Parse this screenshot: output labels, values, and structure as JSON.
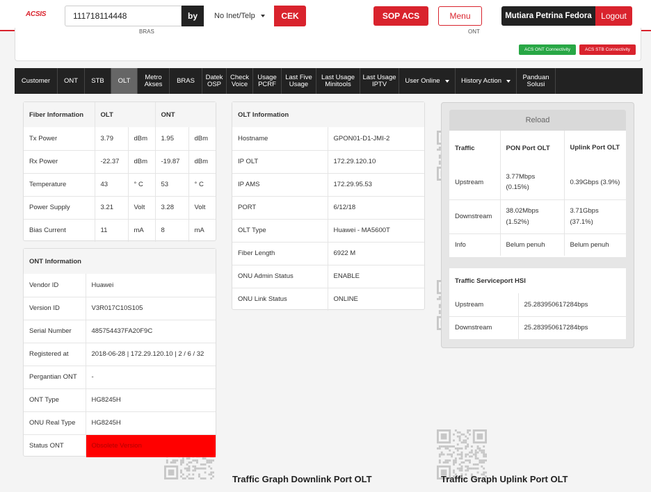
{
  "header": {
    "logo": "ACSIS",
    "logo_sub": "...........",
    "search_value": "111718114448",
    "by_label": "by",
    "select_value": "No Inet/Telp",
    "cek_label": "CEK",
    "sop_label": "SOP ACS",
    "menu_label": "Menu",
    "user_name": "Mutiara Petrina Fedora",
    "logout_label": "Logout"
  },
  "summary": {
    "bras_label": "BRAS",
    "ont_label": "ONT",
    "badge_ont": "ACS ONT Connectivity",
    "badge_stb": "ACS STB Connectivity"
  },
  "tabs": [
    {
      "label": "Customer",
      "w": 62
    },
    {
      "label": "ONT",
      "w": 39
    },
    {
      "label": "STB",
      "w": 38
    },
    {
      "label": "OLT",
      "w": 38,
      "active": true
    },
    {
      "label": "Metro\nAkses",
      "w": 46
    },
    {
      "label": "BRAS",
      "w": 47
    },
    {
      "label": "Datek\nOSP",
      "w": 35
    },
    {
      "label": "Check\nVoice",
      "w": 38
    },
    {
      "label": "Usage\nPCRF",
      "w": 41
    },
    {
      "label": "Last Five\nUsage",
      "w": 50
    },
    {
      "label": "Last Usage\nMinitools",
      "w": 63
    },
    {
      "label": "Last Usage\nIPTV",
      "w": 56
    },
    {
      "label": "User Online",
      "w": 81,
      "dropdown": true
    },
    {
      "label": "History Action",
      "w": 88,
      "dropdown": true
    },
    {
      "label": "Panduan\nSolusi",
      "w": 56
    }
  ],
  "fiber": {
    "headers": [
      "Fiber Information",
      "OLT",
      "ONT"
    ],
    "rows": [
      {
        "label": "Tx Power",
        "olt": "3.79",
        "olt_unit": "dBm",
        "ont": "1.95",
        "ont_unit": "dBm"
      },
      {
        "label": "Rx Power",
        "olt": "-22.37",
        "olt_unit": "dBm",
        "ont": "-19.87",
        "ont_unit": "dBm"
      },
      {
        "label": "Temperature",
        "olt": "43",
        "olt_unit": "° C",
        "ont": "53",
        "ont_unit": "° C"
      },
      {
        "label": "Power Supply",
        "olt": "3.21",
        "olt_unit": "Volt",
        "ont": "3.28",
        "ont_unit": "Volt"
      },
      {
        "label": "Bias Current",
        "olt": "11",
        "olt_unit": "mA",
        "ont": "8",
        "ont_unit": "mA"
      }
    ]
  },
  "ont_info": {
    "title": "ONT Information",
    "rows": [
      {
        "label": "Vendor ID",
        "value": "Huawei"
      },
      {
        "label": "Version ID",
        "value": "V3R017C10S105"
      },
      {
        "label": "Serial Number",
        "value": "485754437FA20F9C"
      },
      {
        "label": "Registered at",
        "value": "2018-06-28 | 172.29.120.10 | 2 / 6 / 32"
      },
      {
        "label": "Pergantian ONT",
        "value": "-"
      },
      {
        "label": "ONT Type",
        "value": "HG8245H"
      },
      {
        "label": "ONU Real Type",
        "value": "HG8245H"
      },
      {
        "label": "Status ONT",
        "value": "Obsolete Version",
        "alert": true
      }
    ]
  },
  "olt_info": {
    "title": "OLT Information",
    "rows": [
      {
        "label": "Hostname",
        "value": "GPON01-D1-JMI-2"
      },
      {
        "label": "IP OLT",
        "value": "172.29.120.10"
      },
      {
        "label": "IP AMS",
        "value": "172.29.95.53"
      },
      {
        "label": "PORT",
        "value": "6/12/18"
      },
      {
        "label": "OLT Type",
        "value": "Huawei - MA5600T"
      },
      {
        "label": "Fiber Length",
        "value": "6922 M"
      },
      {
        "label": "ONU Admin Status",
        "value": "ENABLE"
      },
      {
        "label": "ONU Link Status",
        "value": "ONLINE"
      }
    ]
  },
  "traffic": {
    "reload_label": "Reload",
    "headers": [
      "Traffic",
      "PON Port OLT",
      "Uplink Port OLT"
    ],
    "rows": [
      {
        "label": "Upstream",
        "pon": "3.77Mbps (0.15%)",
        "uplink": "0.39Gbps (3.9%)"
      },
      {
        "label": "Downstream",
        "pon": "38.02Mbps (1.52%)",
        "uplink": "3.71Gbps (37.1%)"
      },
      {
        "label": "Info",
        "pon": "Belum penuh",
        "uplink": "Belum penuh"
      }
    ]
  },
  "serviceport": {
    "title": "Traffic Serviceport HSI",
    "rows": [
      {
        "label": "Upstream",
        "value": "25.283950617284bps"
      },
      {
        "label": "Downstream",
        "value": "25.283950617284bps"
      }
    ]
  },
  "graphs": {
    "downlink_title": "Traffic Graph Downlink Port OLT",
    "uplink_title": "Traffic Graph Uplink Port OLT"
  },
  "colors": {
    "brand_red": "#d9232d",
    "dark": "#222222",
    "alert_red": "#ff0000"
  }
}
